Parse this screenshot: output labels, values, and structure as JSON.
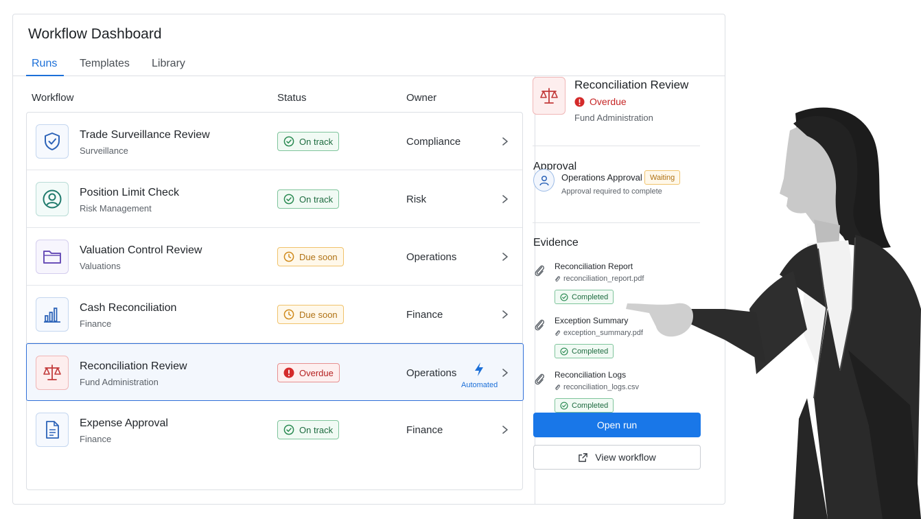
{
  "app": {
    "title": "Workflow Dashboard",
    "tabs": [
      {
        "label": "Runs",
        "active": true
      },
      {
        "label": "Templates",
        "active": false
      },
      {
        "label": "Library",
        "active": false
      }
    ]
  },
  "table": {
    "columns": [
      "Workflow",
      "Status",
      "Owner"
    ],
    "rows": [
      {
        "name": "Trade Surveillance Review",
        "sub": "Surveillance",
        "status": "On track",
        "status_kind": "green",
        "owner": "Compliance",
        "icon": "shield-check-icon"
      },
      {
        "name": "Position Limit Check",
        "sub": "Risk Management",
        "status": "On track",
        "status_kind": "green",
        "owner": "Risk",
        "icon": "user-circle-icon"
      },
      {
        "name": "Valuation Control Review",
        "sub": "Valuations",
        "status": "Due soon",
        "status_kind": "amber",
        "owner": "Operations",
        "icon": "folder-icon"
      },
      {
        "name": "Cash Reconciliation",
        "sub": "Finance",
        "status": "Due soon",
        "status_kind": "amber",
        "owner": "Finance",
        "icon": "bar-chart-icon"
      },
      {
        "name": "Reconciliation Review",
        "sub": "Fund Administration",
        "status": "Overdue",
        "status_kind": "red",
        "owner": "Operations",
        "icon": "scale-icon",
        "selected": true,
        "tag": "Automated"
      },
      {
        "name": "Expense Approval",
        "sub": "Finance",
        "status": "On track",
        "status_kind": "green",
        "owner": "Finance",
        "icon": "document-icon"
      }
    ]
  },
  "detail": {
    "title": "Reconciliation Review",
    "status": "Overdue",
    "sub": "Fund Administration",
    "approval": {
      "heading": "Approval",
      "name": "Operations Approval",
      "state": "Waiting",
      "note": "Approval required to complete"
    },
    "evidence": {
      "heading": "Evidence",
      "items": [
        {
          "name": "Reconciliation Report",
          "file": "reconciliation_report.pdf",
          "status": "Completed"
        },
        {
          "name": "Exception Summary",
          "file": "exception_summary.pdf",
          "status": "Completed"
        },
        {
          "name": "Reconciliation Logs",
          "file": "reconciliation_logs.csv",
          "status": "Completed"
        }
      ]
    },
    "primary_button": "Open run",
    "secondary_button": "View workflow"
  },
  "colors": {
    "accent": "#1977e8",
    "on_track": "#1d6b3f",
    "due_soon": "#b07214",
    "overdue": "#c62525"
  }
}
